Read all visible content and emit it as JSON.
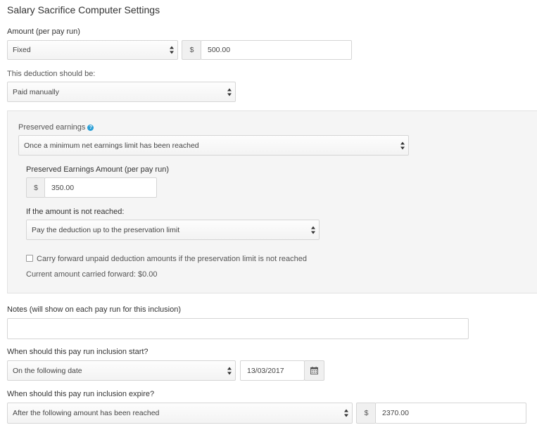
{
  "page": {
    "title": "Salary Sacrifice Computer Settings"
  },
  "amount": {
    "label": "Amount (per pay run)",
    "type_value": "Fixed",
    "currency": "$",
    "value": "500.00"
  },
  "deduction": {
    "label": "This deduction should be:",
    "value": "Paid manually"
  },
  "preserved": {
    "label": "Preserved earnings",
    "help_icon": "question-circle-icon",
    "value": "Once a minimum net earnings limit has been reached",
    "amount_label": "Preserved Earnings Amount (per pay run)",
    "currency": "$",
    "amount_value": "350.00",
    "not_reached_label": "If the amount is not reached:",
    "not_reached_value": "Pay the deduction up to the preservation limit",
    "carry_forward_label": "Carry forward unpaid deduction amounts if the preservation limit is not reached",
    "carry_forward_checked": false,
    "current_carried": "Current amount carried forward: $0.00"
  },
  "notes": {
    "label": "Notes (will show on each pay run for this inclusion)",
    "value": ""
  },
  "start": {
    "label": "When should this pay run inclusion start?",
    "value": "On the following date",
    "date": "13/03/2017",
    "calendar_icon": "calendar-icon"
  },
  "expire": {
    "label": "When should this pay run inclusion expire?",
    "value": "After the following amount has been reached",
    "currency": "$",
    "amount": "2370.00"
  },
  "colors": {
    "help_icon": "#2a9fd6",
    "panel_bg": "#f5f5f5",
    "border": "#d5d5d5"
  }
}
